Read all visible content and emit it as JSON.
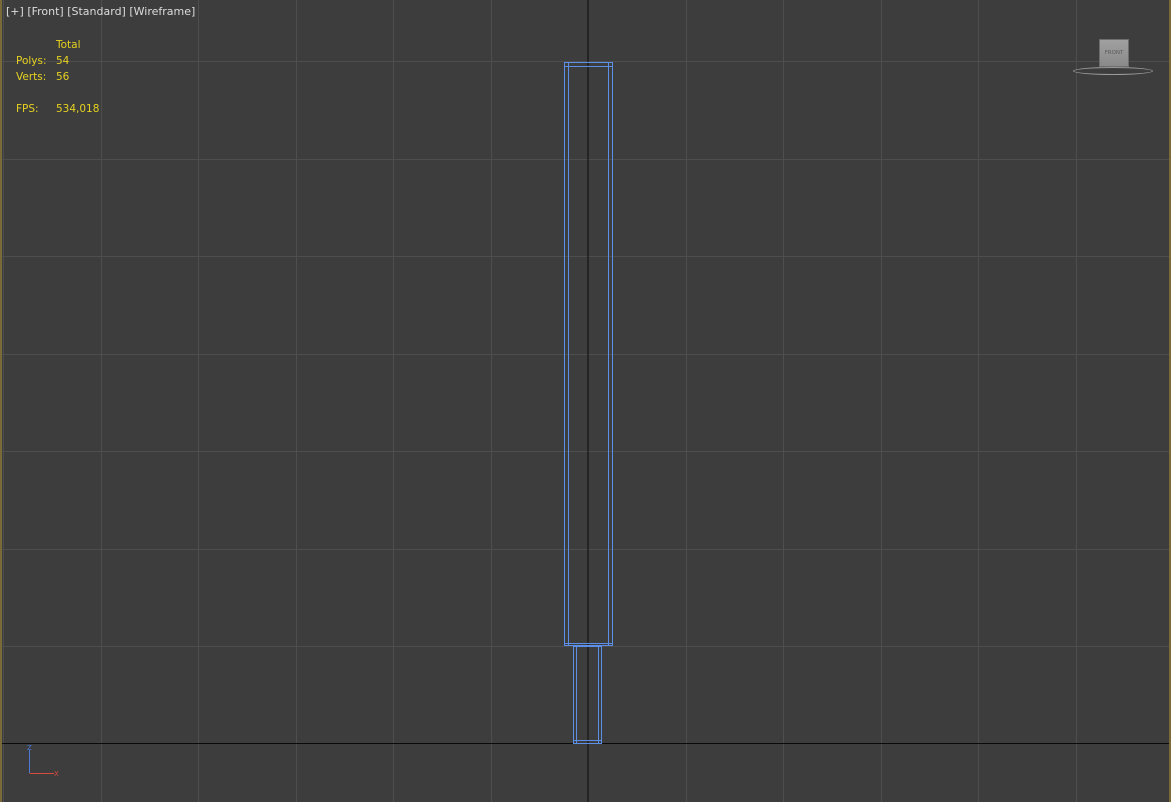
{
  "viewport": {
    "label_plus": "[+]",
    "label_view": "[Front]",
    "label_shading_standard": "[Standard]",
    "label_shading_mode": "[Wireframe]"
  },
  "stats": {
    "header": "Total",
    "polys_label": "Polys:",
    "polys_value": "54",
    "verts_label": "Verts:",
    "verts_value": "56",
    "fps_label": "FPS:",
    "fps_value": "534,018"
  },
  "viewcube": {
    "face_label": "FRONT"
  },
  "axis_tripod": {
    "vertical_axis": "Z",
    "horizontal_axis": "X"
  },
  "colors": {
    "background": "#3d3d3d",
    "grid_line": "#4e4e4e",
    "world_axis": "#0a0a0a",
    "wireframe": "#5b8fe8",
    "stats_text": "#e6d21f",
    "label_text": "#dcdcdc",
    "viewport_border": "#7a6a3a"
  },
  "icons": {
    "viewcube": "viewcube-icon",
    "axis_tripod": "axis-tripod-icon"
  }
}
